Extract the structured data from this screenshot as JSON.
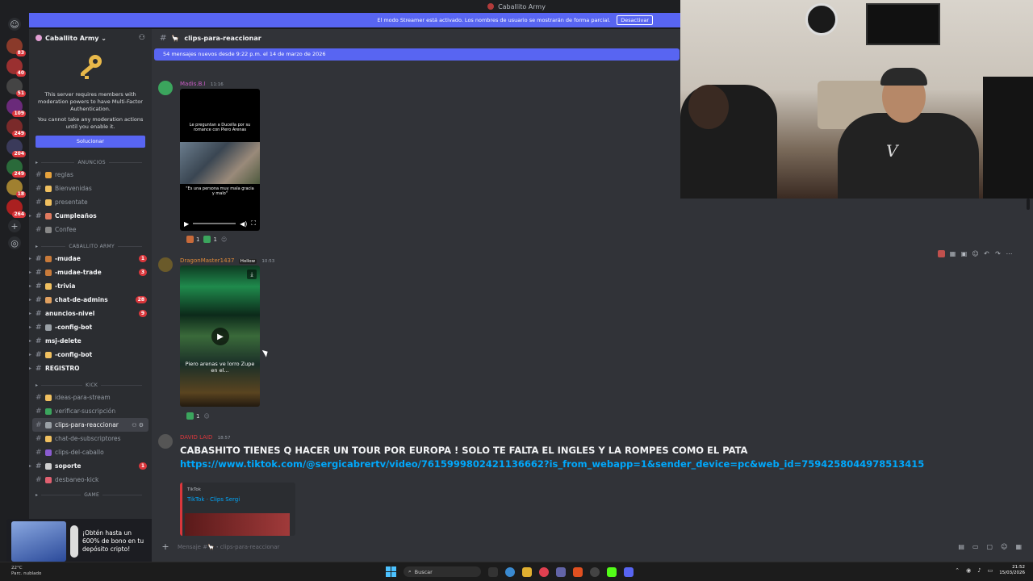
{
  "titlebar": {
    "title": "Caballito Army"
  },
  "streamer_bar": {
    "text": "El modo Streamer está activado. Los nombres de usuario se mostrarán de forma parcial.",
    "button": "Desactivar"
  },
  "rail": {
    "badges": [
      "83",
      "40",
      "51",
      "109",
      "249",
      "204",
      "249",
      "18",
      "264"
    ]
  },
  "server": {
    "name": "Caballito Army ⌄",
    "mfa_text": "This server requires members with moderation powers to have Multi-Factor Authentication.",
    "mfa_text2": "You cannot take any moderation actions until you enable it.",
    "mfa_button": "Solucionar"
  },
  "categories": {
    "anuncios": "ANUNCIOS",
    "army": "CABALLITO ARMY",
    "kick": "KICK",
    "game": "GAME"
  },
  "channels_anuncios": [
    {
      "label": "reglas",
      "color": "#e6a23c",
      "state": "normal"
    },
    {
      "label": "Bienvenidas",
      "color": "#f0c060",
      "state": "normal"
    },
    {
      "label": "presentate",
      "color": "#f0c060",
      "state": "normal"
    },
    {
      "label": "Cumpleaños",
      "color": "#e07a5f",
      "state": "unread"
    },
    {
      "label": "Confee",
      "color": "#888888",
      "state": "normal"
    }
  ],
  "channels_army": [
    {
      "label": "-mudae",
      "color": "#c87a3a",
      "state": "unread",
      "badge": "1"
    },
    {
      "label": "-mudae-trade",
      "color": "#c87a3a",
      "state": "unread",
      "badge": "3"
    },
    {
      "label": "-trivia",
      "color": "#f0c060",
      "state": "unread",
      "badge": ""
    },
    {
      "label": "chat-de-admins",
      "color": "#e0a060",
      "state": "unread",
      "badge": "28"
    },
    {
      "label": "anuncios-nivel",
      "color": "",
      "state": "unread",
      "badge": "9"
    },
    {
      "label": "-config-bot",
      "color": "#9aa0a6",
      "state": "unread",
      "badge": ""
    },
    {
      "label": "msj-delete",
      "color": "",
      "state": "unread",
      "badge": ""
    },
    {
      "label": "-config-bot",
      "color": "#f0c060",
      "state": "unread",
      "badge": ""
    },
    {
      "label": "REGISTRO",
      "color": "",
      "state": "unread",
      "badge": ""
    }
  ],
  "channels_kick": [
    {
      "label": "ideas-para-stream",
      "color": "#f0c060",
      "state": "normal",
      "badge": ""
    },
    {
      "label": "verificar-suscripción",
      "color": "#3ba55d",
      "state": "normal",
      "badge": ""
    },
    {
      "label": "clips-para-reaccionar",
      "color": "#9aa0a6",
      "state": "active",
      "badge": ""
    },
    {
      "label": "chat-de-subscriptores",
      "color": "#f0c060",
      "state": "normal",
      "badge": ""
    },
    {
      "label": "clips-del-caballo",
      "color": "#8a5cd0",
      "state": "normal",
      "badge": ""
    },
    {
      "label": "soporte",
      "color": "#cfcfcf",
      "state": "unread",
      "badge": "1"
    },
    {
      "label": "desbaneo-kick",
      "color": "#e06070",
      "state": "normal",
      "badge": ""
    }
  ],
  "header": {
    "channel": "clips-para-reaccionar"
  },
  "new_messages": "54 mensajes nuevos desde 9:22 p.m. el 14 de marzo de 2026",
  "messages": [
    {
      "user": "Madis.B.I",
      "time": "11:16",
      "user_color": "#c75cc4",
      "video_caption_top": "Le preguntan a Ducella por su romance con Piero Arenas",
      "video_caption_bottom": "\"Es una persona muy mala gracia y malo\"",
      "reactions": [
        "1",
        "1"
      ]
    },
    {
      "user": "DragonMaster1437",
      "tag": "Hollow",
      "time": "10:53",
      "user_color": "#e08a3a",
      "video_caption": "Piero arenas ve lorro Zupe en el...",
      "reactions": [
        "1"
      ]
    },
    {
      "user": "DAVID LAID",
      "time": "18:57",
      "user_color": "#da373c",
      "text": "CABASHITO TIENES Q HACER UN TOUR POR EUROPA ! SOLO TE FALTA EL INGLES Y LA ROMPES COMO EL PATA",
      "link": "https://www.tiktok.com/@sergicabrertv/video/7615999802421136662?is_from_webapp=1&sender_device=pc&web_id=7594258044978513415",
      "embed_provider": "TikTok",
      "embed_title": "TikTok · Clips Sergi"
    }
  ],
  "composer": {
    "placeholder": "Mensaje #🦙・clips-para-reaccionar"
  },
  "ad": {
    "text": "¡Obtén hasta un 600% de bono en tu depósito cripto!"
  },
  "taskbar": {
    "weather_temp": "22°C",
    "weather_desc": "Parc. nublado",
    "search": "Buscar",
    "time": "21:52",
    "date": "15/03/2026"
  }
}
